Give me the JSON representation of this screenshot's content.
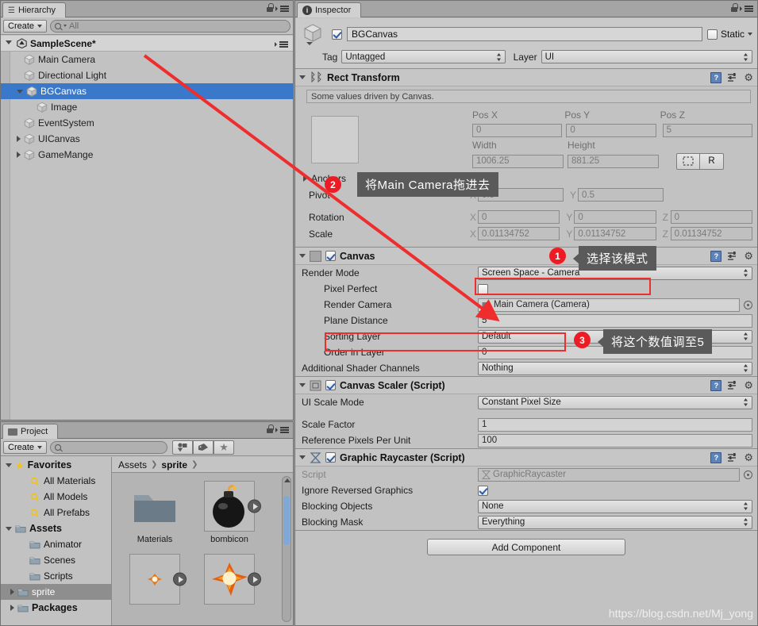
{
  "hierarchy": {
    "tab_label": "Hierarchy",
    "tab_icon": "hierarchy-icon",
    "create_label": "Create",
    "search_placeholder": "All",
    "scene_name": "SampleScene*",
    "items": [
      {
        "label": "Main Camera",
        "depth": 2,
        "expandable": false,
        "selected": false
      },
      {
        "label": "Directional Light",
        "depth": 2,
        "expandable": false,
        "selected": false
      },
      {
        "label": "BGCanvas",
        "depth": 2,
        "expandable": true,
        "expanded": true,
        "selected": true
      },
      {
        "label": "Image",
        "depth": 3,
        "expandable": false,
        "selected": false
      },
      {
        "label": "EventSystem",
        "depth": 2,
        "expandable": false,
        "selected": false
      },
      {
        "label": "UICanvas",
        "depth": 2,
        "expandable": true,
        "expanded": false,
        "selected": false
      },
      {
        "label": "GameMange",
        "depth": 2,
        "expandable": true,
        "expanded": false,
        "selected": false
      }
    ]
  },
  "project": {
    "tab_label": "Project",
    "create_label": "Create",
    "search_placeholder": "",
    "toolbar_icons": [
      "filter-by-type-icon",
      "filter-by-label-icon",
      "favorite-star-icon"
    ],
    "tree": [
      {
        "label": "Favorites",
        "kind": "star",
        "bold": true,
        "depth": 0,
        "expanded": true,
        "selected": false
      },
      {
        "label": "All Materials",
        "kind": "search",
        "bold": false,
        "depth": 1,
        "selected": false
      },
      {
        "label": "All Models",
        "kind": "search",
        "bold": false,
        "depth": 1,
        "selected": false
      },
      {
        "label": "All Prefabs",
        "kind": "search",
        "bold": false,
        "depth": 1,
        "selected": false
      },
      {
        "label": "Assets",
        "kind": "folder",
        "bold": true,
        "depth": 0,
        "expanded": true,
        "selected": false
      },
      {
        "label": "Animator",
        "kind": "folder",
        "bold": false,
        "depth": 1,
        "selected": false
      },
      {
        "label": "Scenes",
        "kind": "folder",
        "bold": false,
        "depth": 1,
        "selected": false
      },
      {
        "label": "Scripts",
        "kind": "folder",
        "bold": false,
        "depth": 1,
        "selected": false
      },
      {
        "label": "sprite",
        "kind": "folder",
        "bold": false,
        "depth": 1,
        "expandable": true,
        "selected": true
      },
      {
        "label": "Packages",
        "kind": "folder",
        "bold": true,
        "depth": 0,
        "expandable": true,
        "selected": false
      }
    ],
    "breadcrumbs": [
      "Assets",
      "sprite"
    ],
    "assets": [
      {
        "label": "Materials",
        "type": "folder",
        "has_play": false
      },
      {
        "label": "bombicon",
        "type": "bomb",
        "has_play": true
      },
      {
        "label": "",
        "type": "spark-small",
        "has_play": true
      },
      {
        "label": "",
        "type": "spark-big",
        "has_play": true
      }
    ]
  },
  "inspector": {
    "tab_label": "Inspector",
    "tab_icon": "info-icon",
    "game_object": {
      "enabled": true,
      "name": "BGCanvas",
      "static_label": "Static",
      "static_checked": false,
      "tag_label": "Tag",
      "tag_value": "Untagged",
      "layer_label": "Layer",
      "layer_value": "UI"
    },
    "rect_transform": {
      "title": "Rect Transform",
      "enabled": true,
      "note": "Some values driven by Canvas.",
      "col_headers": [
        "Pos X",
        "Pos Y",
        "Pos Z"
      ],
      "pos": [
        "0",
        "0",
        "5"
      ],
      "size_headers": [
        "Width",
        "Height"
      ],
      "size": [
        "1006.25",
        "881.25"
      ],
      "anchors_label": "Anchors",
      "pivot_label": "Pivot",
      "pivot": [
        "0.5",
        "0.5"
      ],
      "rotation_label": "Rotation",
      "rotation": [
        "0",
        "0",
        "0"
      ],
      "scale_label": "Scale",
      "scale": [
        "0.01134752",
        "0.01134752",
        "0.01134752"
      ],
      "blockbtn_label": "R"
    },
    "canvas": {
      "title": "Canvas",
      "enabled": true,
      "fields": [
        {
          "label": "Render Mode",
          "value": "Screen Space - Camera",
          "type": "popup",
          "highlight": true
        },
        {
          "label": "Pixel Perfect",
          "value": "",
          "type": "check",
          "checked": false,
          "indent": 1
        },
        {
          "label": "Render Camera",
          "value": "Main Camera (Camera)",
          "type": "object",
          "indent": 1
        },
        {
          "label": "Plane Distance",
          "value": "5",
          "type": "text",
          "indent": 1,
          "highlight": true
        },
        {
          "label": "Sorting Layer",
          "value": "Default",
          "type": "popup",
          "indent": 1
        },
        {
          "label": "Order in Layer",
          "value": "0",
          "type": "text",
          "indent": 1
        },
        {
          "label": "Additional Shader Channels",
          "value": "Nothing",
          "type": "popup",
          "indent": 0
        }
      ]
    },
    "canvas_scaler": {
      "title": "Canvas Scaler (Script)",
      "enabled": true,
      "fields": [
        {
          "label": "UI Scale Mode",
          "value": "Constant Pixel Size",
          "type": "popup"
        },
        {
          "label": "Scale Factor",
          "value": "1",
          "type": "text"
        },
        {
          "label": "Reference Pixels Per Unit",
          "value": "100",
          "type": "text"
        }
      ]
    },
    "graphic_raycaster": {
      "title": "Graphic Raycaster (Script)",
      "enabled": true,
      "fields": [
        {
          "label": "Script",
          "value": "GraphicRaycaster",
          "type": "object",
          "dim": true
        },
        {
          "label": "Ignore Reversed Graphics",
          "value": "",
          "type": "check",
          "checked": true
        },
        {
          "label": "Blocking Objects",
          "value": "None",
          "type": "popup"
        },
        {
          "label": "Blocking Mask",
          "value": "Everything",
          "type": "popup"
        }
      ]
    },
    "add_component_label": "Add Component"
  },
  "annotations": {
    "accent_color": "#ed1c24",
    "callout_bg": "#5a5a5a",
    "items": [
      {
        "number": "1",
        "text": "选择该模式"
      },
      {
        "number": "2",
        "text": "将Main Camera拖进去"
      },
      {
        "number": "3",
        "text": "将这个数值调至5"
      }
    ]
  },
  "watermark": {
    "text": "https://blog.csdn.net/Mj_yong"
  }
}
